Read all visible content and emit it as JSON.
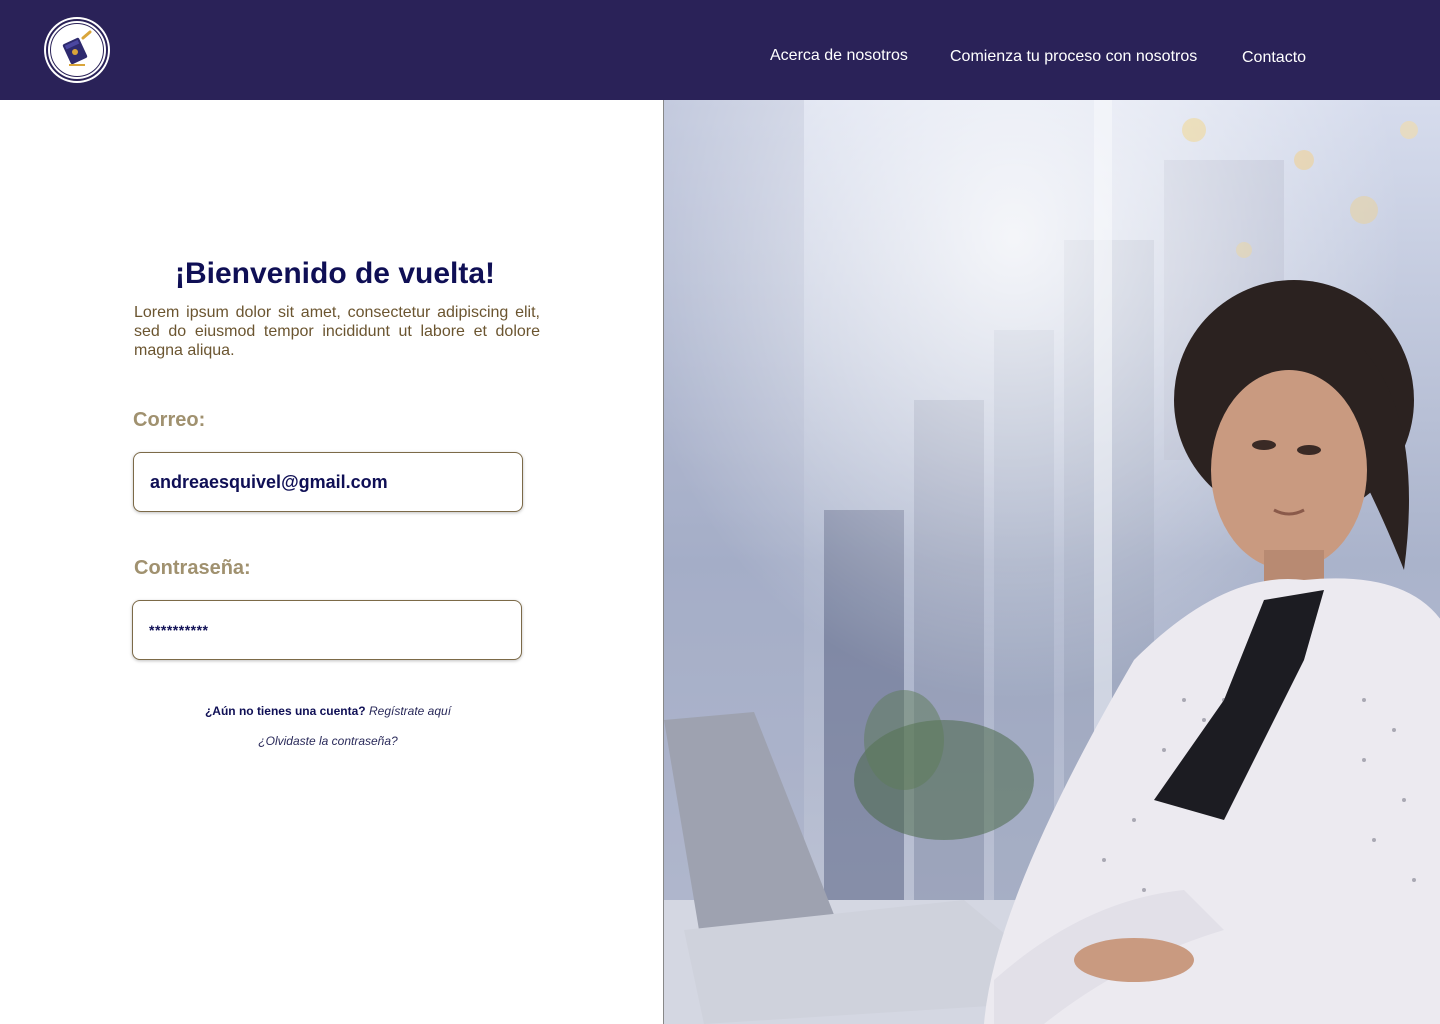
{
  "header": {
    "logo_icon": "book-pen-icon",
    "nav": [
      {
        "label": "Acerca de nosotros"
      },
      {
        "label": "Comienza tu proceso con nosotros"
      },
      {
        "label": "Contacto"
      }
    ]
  },
  "login": {
    "title": "¡Bienvenido de vuelta!",
    "intro": "Lorem ipsum dolor sit amet, consectetur adipiscing elit, sed do eiusmod tempor incididunt ut labore et dolore magna aliqua.",
    "email_label": "Correo:",
    "email_value": "andreaesquivel@gmail.com",
    "password_label": "Contraseña:",
    "password_value": "**********",
    "no_account": "¿Aún no tienes una cuenta?",
    "register_link": "Regístrate aquí",
    "forgot_link": "¿Olvidaste la contraseña?"
  },
  "colors": {
    "header_bg": "#2a2258",
    "title": "#0f0f55",
    "label": "#a0916f",
    "intro_text": "#6b5530"
  }
}
